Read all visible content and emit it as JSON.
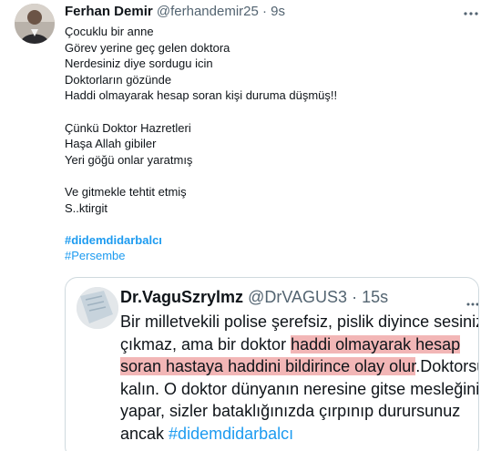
{
  "tweet": {
    "author_name": "Ferhan Demir",
    "author_handle": "@ferhandemir25",
    "separator": "·",
    "time": "9s",
    "lines": [
      "Çocuklu bir anne",
      "Görev yerine geç gelen doktora",
      "Nerdesiniz diye sordugu icin",
      "Doktorların gözünde",
      "Haddi olmayarak hesap soran kişi duruma düşmüş!!",
      "",
      "Çünkü Doktor Hazretleri",
      "Haşa Allah gibiler",
      "Yeri göğü onlar yaratmış",
      "",
      "Ve gitmekle tehtit etmiş",
      "S..ktirgit",
      ""
    ],
    "hashtags": [
      "#didemdidarbalcı",
      "#Persembe"
    ]
  },
  "quote": {
    "author_name": "Dr.VaguSzrylmz",
    "author_handle": "@DrVAGUS3",
    "separator": "·",
    "time": "15s",
    "line1": "Bir milletvekili polise şerefsiz, pislik diyince sesiniz",
    "line2_a": "çıkmaz, ama bir doktor ",
    "line2_hl": "haddi olmayarak hesap",
    "line3_hl": "soran hastaya haddini bildirince olay olur",
    "line3_b": ".Doktorsu",
    "line4": "kalın. O doktor dünyanın neresine gitse mesleğini",
    "line5": "yapar, sizler bataklığınızda çırpınıp durursunuz",
    "line6_a": "ancak ",
    "line6_hashtag": "#didemdidarbalcı"
  },
  "colors": {
    "text": "#0f1419",
    "secondary": "#536471",
    "link": "#1d9bf0",
    "highlight": "#f2b6b6",
    "border": "#cfd9de"
  },
  "icons": {
    "more": "more-horizontal-icon"
  }
}
